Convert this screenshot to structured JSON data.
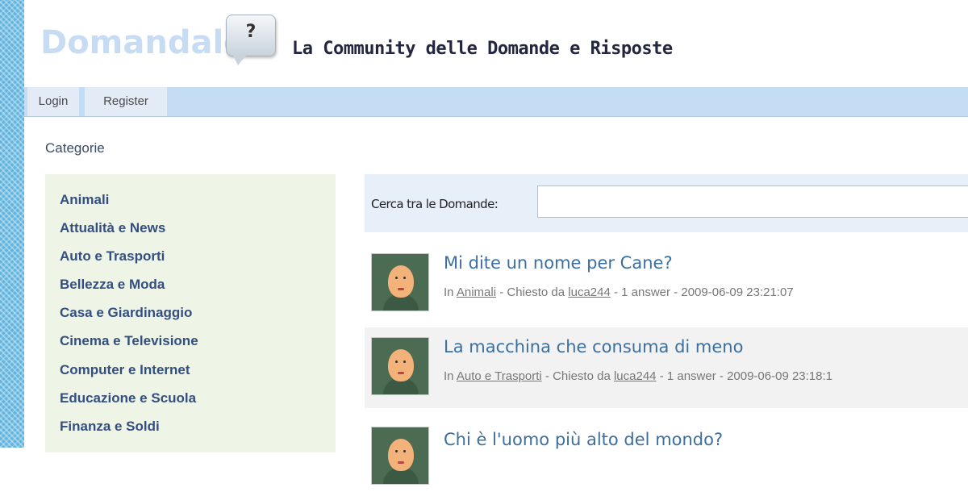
{
  "header": {
    "logo": "Domandalo",
    "logo_bubble": "?",
    "tagline": "La Community delle Domande e Risposte"
  },
  "nav": {
    "login": "Login",
    "register": "Register"
  },
  "sidebar": {
    "title": "Categorie",
    "items": [
      "Animali",
      "Attualità e News",
      "Auto e Trasporti",
      "Bellezza e Moda",
      "Casa e Giardinaggio",
      "Cinema e Televisione",
      "Computer e Internet",
      "Educazione e Scuola",
      "Finanza e Soldi"
    ]
  },
  "search": {
    "label": "Cerca tra le Domande:",
    "value": ""
  },
  "questions": [
    {
      "title": "Mi dite un nome per Cane?",
      "prefix": "In",
      "category": "Animali",
      "asked_by_label": "- Chiesto da",
      "user": "luca244",
      "answers": "- 1 answer -",
      "datetime": "2009-06-09 23:21:07"
    },
    {
      "title": "La macchina che consuma di meno",
      "prefix": "In",
      "category": "Auto e Trasporti",
      "asked_by_label": "- Chiesto da",
      "user": "luca244",
      "answers": "- 1 answer -",
      "datetime": "2009-06-09 23:18:1"
    },
    {
      "title": "Chi è l'uomo più alto del mondo?"
    }
  ]
}
